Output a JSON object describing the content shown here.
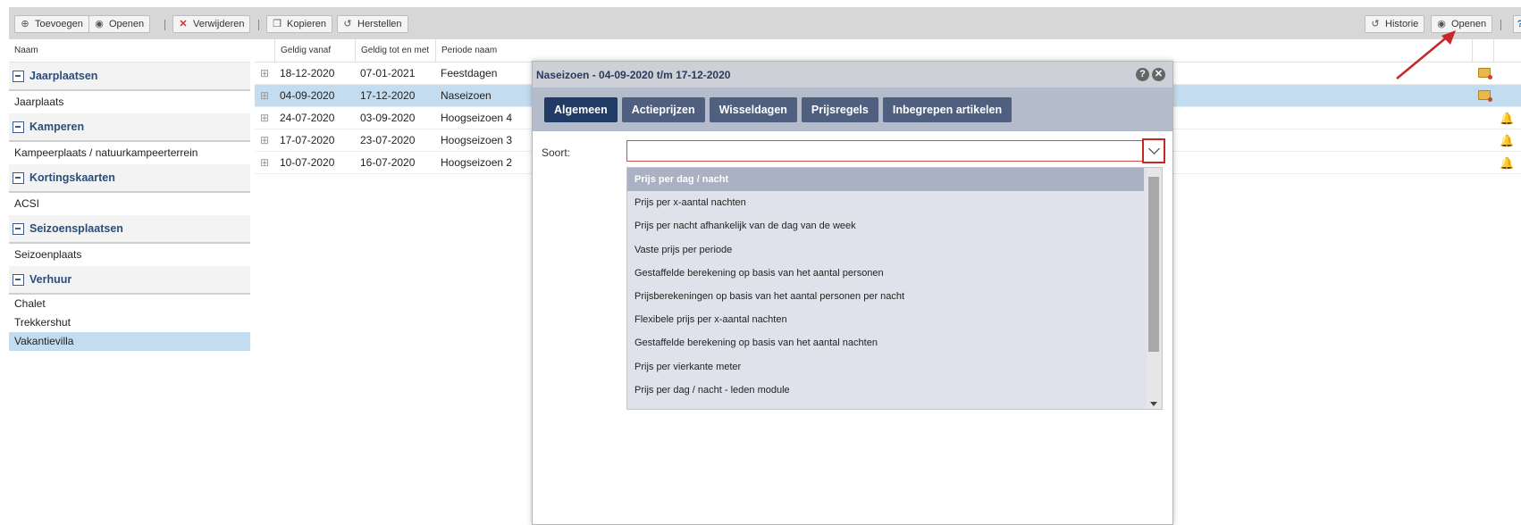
{
  "toolbar": {
    "add_label": "Toevoegen",
    "open_label": "Openen",
    "delete_label": "Verwijderen",
    "copy_label": "Kopieren",
    "restore_label": "Herstellen",
    "history_label": "Historie",
    "open_right_label": "Openen",
    "help_label": "?"
  },
  "left_pane": {
    "header": "Naam",
    "groups": [
      {
        "label": "Jaarplaatsen",
        "items": [
          "Jaarplaats"
        ]
      },
      {
        "label": "Kamperen",
        "items": [
          "Kampeerplaats / natuurkampeerterrein"
        ]
      },
      {
        "label": "Kortingskaarten",
        "items": [
          "ACSI"
        ]
      },
      {
        "label": "Seizoensplaatsen",
        "items": [
          "Seizoenplaats"
        ]
      },
      {
        "label": "Verhuur",
        "items": [
          "Chalet",
          "Trekkershut",
          "Vakantievilla"
        ]
      }
    ],
    "selected_item": "Vakantievilla"
  },
  "grid": {
    "headers": [
      "Geldig vanaf",
      "Geldig tot en met",
      "Periode naam"
    ],
    "rows": [
      {
        "from": "18-12-2020",
        "to": "07-01-2021",
        "name": "Feestdagen",
        "icon": "folder-icon"
      },
      {
        "from": "04-09-2020",
        "to": "17-12-2020",
        "name": "Naseizoen",
        "icon": "folder-icon"
      },
      {
        "from": "24-07-2020",
        "to": "03-09-2020",
        "name": "Hoogseizoen 4",
        "icon": "bell-icon"
      },
      {
        "from": "17-07-2020",
        "to": "23-07-2020",
        "name": "Hoogseizoen 3",
        "icon": "bell-icon"
      },
      {
        "from": "10-07-2020",
        "to": "16-07-2020",
        "name": "Hoogseizoen 2",
        "icon": "bell-icon"
      }
    ],
    "selected_row": 1
  },
  "modal": {
    "title": "Naseizoen - 04-09-2020 t/m 17-12-2020",
    "tabs": [
      "Algemeen",
      "Actieprijzen",
      "Wisseldagen",
      "Prijsregels",
      "Inbegrepen artikelen"
    ],
    "active_tab": "Algemeen",
    "field_label": "Soort:",
    "select_value": "",
    "options": [
      "Prijs per dag / nacht",
      "Prijs per x-aantal nachten",
      "Prijs per nacht afhankelijk van de dag van de week",
      "Vaste prijs per periode",
      "Gestaffelde berekening op basis van het aantal personen",
      "Prijsberekeningen op basis van het aantal personen per nacht",
      "Flexibele prijs per x-aantal nachten",
      "Gestaffelde berekening op basis van het aantal nachten",
      "Prijs per vierkante meter",
      "Prijs per dag / nacht - leden module"
    ],
    "highlighted_option": "Prijs per dag / nacht"
  },
  "colors": {
    "toolbar_bg": "#d7d7d7",
    "selection": "#c3dcf0",
    "tab_active": "#1f3b66",
    "tab": "#4f5f7f",
    "annotation_red": "#c62828"
  }
}
